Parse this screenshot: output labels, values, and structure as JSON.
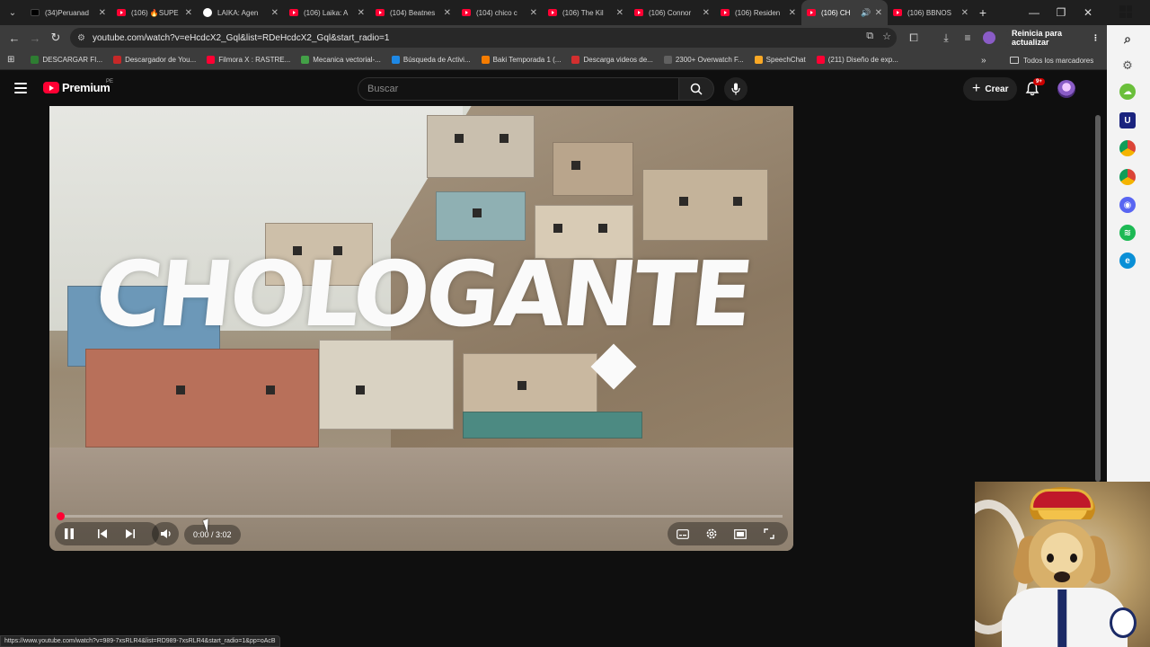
{
  "browser": {
    "tabs": [
      {
        "title": "(34)Peruanad",
        "icon": "tiktok-icon",
        "active": false
      },
      {
        "title": "(106) 🔥SUPE",
        "icon": "youtube-icon",
        "active": false
      },
      {
        "title": "LAIKA: Agen",
        "icon": "google-icon",
        "active": false
      },
      {
        "title": "(106) Laika: A",
        "icon": "youtube-icon",
        "active": false
      },
      {
        "title": "(104) Beatnes",
        "icon": "youtube-icon",
        "active": false
      },
      {
        "title": "(104) chico c",
        "icon": "youtube-icon",
        "active": false
      },
      {
        "title": "(106) The Kil",
        "icon": "youtube-icon",
        "active": false
      },
      {
        "title": "(106) Connor",
        "icon": "youtube-icon",
        "active": false
      },
      {
        "title": "(106) Residen",
        "icon": "youtube-icon",
        "active": false
      },
      {
        "title": "(106) CH",
        "icon": "youtube-icon",
        "active": true
      },
      {
        "title": "(106) BBNOS",
        "icon": "youtube-icon",
        "active": false
      }
    ],
    "url": "youtube.com/watch?v=eHcdcX2_Gql&list=RDeHcdcX2_Gql&start_radio=1",
    "relaunch_label": "Reinicia para actualizar",
    "bookmarks": [
      {
        "label": "DESCARGAR FI...",
        "color": "#2e7d32"
      },
      {
        "label": "Descargador de You...",
        "color": "#c62828"
      },
      {
        "label": "Filmora X : RASTRE...",
        "color": "#ff0033"
      },
      {
        "label": "Mecanica vectorial-...",
        "color": "#43a047"
      },
      {
        "label": "Búsqueda de Activi...",
        "color": "#1e88e5"
      },
      {
        "label": "Baki Temporada 1 (...",
        "color": "#f57c00"
      },
      {
        "label": "Descarga videos de...",
        "color": "#d32f2f"
      },
      {
        "label": "2300+ Overwatch F...",
        "color": "#616161"
      },
      {
        "label": "SpeechChat",
        "color": "#f9a825"
      },
      {
        "label": "(211) Diseño de exp...",
        "color": "#ff0033"
      }
    ],
    "all_bookmarks_label": "Todos los marcadores",
    "status_url": "https://www.youtube.com/watch?v=989-7xsRLR4&list=RD989-7xsRLR4&start_radio=1&pp=oAcB"
  },
  "youtube": {
    "logo_text": "Premium",
    "region": "PE",
    "search_placeholder": "Buscar",
    "create_label": "Crear",
    "notifications_badge": "9+"
  },
  "player": {
    "title_art": "CHOLOGANTE",
    "time_display": "0:00 / 3:02",
    "current_time": "0:00",
    "duration": "3:02",
    "progress": 0.0
  },
  "colors": {
    "accent": "#ff0033",
    "background": "#0f0f0f"
  }
}
